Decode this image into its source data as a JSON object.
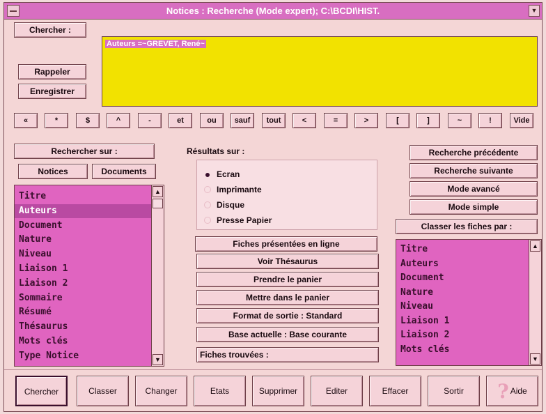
{
  "window": {
    "title": "Notices : Recherche (Mode expert); C:\\BCDI\\HIST."
  },
  "search": {
    "label": "Chercher :",
    "recall_label": "Rappeler",
    "save_label": "Enregistrer",
    "query": "Auteurs =~GREVET, René~"
  },
  "operators": [
    "«",
    "*",
    "$",
    "^",
    "-",
    "et",
    "ou",
    "sauf",
    "tout",
    "<",
    "=",
    ">",
    "[",
    "]",
    "~",
    "!",
    "Vide"
  ],
  "search_on": {
    "label": "Rechercher sur :",
    "tabs": [
      "Notices",
      "Documents"
    ],
    "items": [
      "Titre",
      "Auteurs",
      "Document",
      "Nature",
      "Niveau",
      "Liaison 1",
      "Liaison 2",
      "Sommaire",
      "Résumé",
      "Thésaurus",
      "Mots clés",
      "Type Notice"
    ],
    "selected": "Auteurs"
  },
  "results": {
    "label": "Résultats sur :",
    "options": [
      "Ecran",
      "Imprimante",
      "Disque",
      "Presse Papier"
    ],
    "selected": "Ecran"
  },
  "actions": [
    "Fiches présentées en ligne",
    "Voir Thésaurus",
    "Prendre le panier",
    "Mettre dans le panier",
    "Format de sortie : Standard",
    "Base actuelle : Base courante"
  ],
  "found": {
    "label": "Fiches trouvées :"
  },
  "nav": [
    "Recherche précédente",
    "Recherche suivante",
    "Mode avancé",
    "Mode simple"
  ],
  "sort": {
    "label": "Classer les fiches  par :",
    "items": [
      "Titre",
      "Auteurs",
      "Document",
      "Nature",
      "Niveau",
      "Liaison 1",
      "Liaison 2",
      "Mots clés"
    ]
  },
  "bottom": [
    "Chercher",
    "Classer",
    "Changer",
    "Etats",
    "Supprimer",
    "Editer",
    "Effacer",
    "Sortir",
    "Aide"
  ],
  "colors": {
    "query_bg": "#f2e200",
    "list_bg": "#e064c0",
    "title_bg": "#d86ec1",
    "window_bg": "#f4d6d6"
  }
}
